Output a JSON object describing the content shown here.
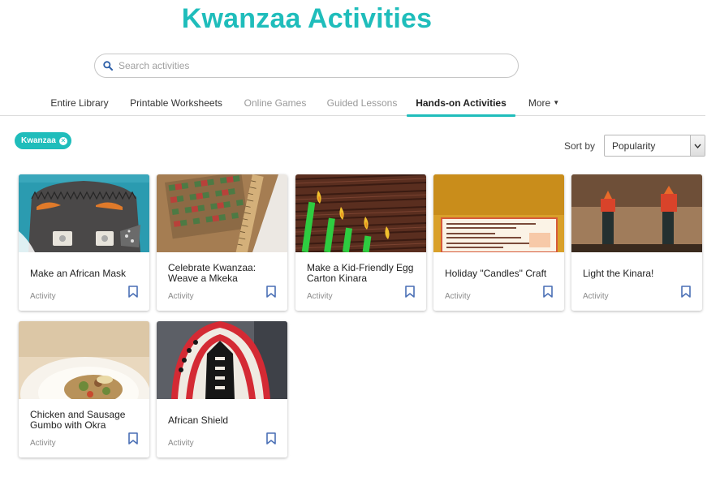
{
  "page": {
    "title": "Kwanzaa Activities"
  },
  "search": {
    "placeholder": "Search activities",
    "icon": "search-icon"
  },
  "tabs": [
    {
      "label": "Entire Library",
      "state": "normal"
    },
    {
      "label": "Printable Worksheets",
      "state": "normal"
    },
    {
      "label": "Online Games",
      "state": "dim"
    },
    {
      "label": "Guided Lessons",
      "state": "dim"
    },
    {
      "label": "Hands-on Activities",
      "state": "active"
    },
    {
      "label": "More",
      "state": "normal"
    }
  ],
  "filter": {
    "chip_label": "Kwanzaa"
  },
  "sort": {
    "label": "Sort by",
    "selected": "Popularity"
  },
  "cards": [
    {
      "title": "Make an African Mask",
      "kind": "Activity"
    },
    {
      "title": "Celebrate Kwanzaa: Weave a Mkeka",
      "kind": "Activity"
    },
    {
      "title": "Make a Kid-Friendly Egg Carton Kinara",
      "kind": "Activity"
    },
    {
      "title": "Holiday \"Candles\" Craft",
      "kind": "Activity"
    },
    {
      "title": "Light the Kinara!",
      "kind": "Activity"
    },
    {
      "title": "Chicken and Sausage Gumbo with Okra",
      "kind": "Activity"
    },
    {
      "title": "African Shield",
      "kind": "Activity"
    }
  ],
  "colors": {
    "accent": "#1fbdbb",
    "bookmark": "#4a6fb5"
  }
}
